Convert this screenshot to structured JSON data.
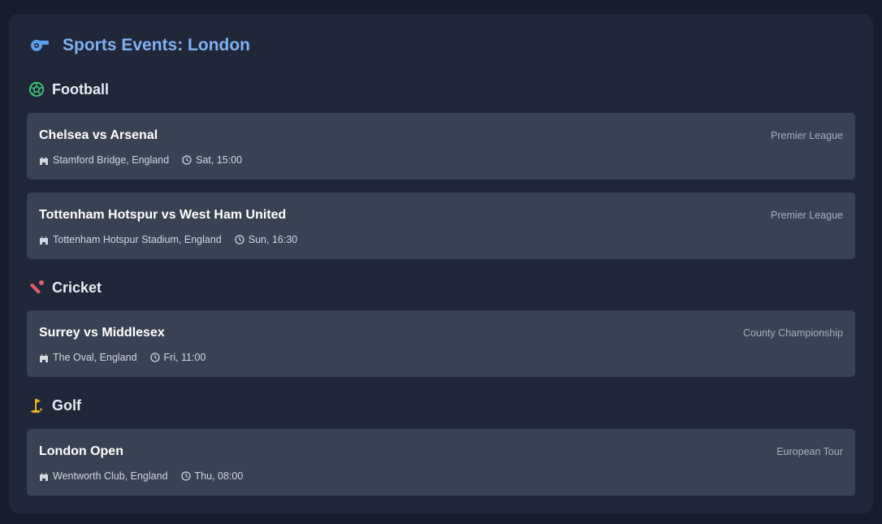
{
  "header": {
    "title": "Sports Events: London",
    "icon": "whistle-icon",
    "color": "#7fb1f0"
  },
  "sections": [
    {
      "title": "Football",
      "icon": "football-icon",
      "icon_color": "#3ec97a",
      "events": [
        {
          "match": "Chelsea vs Arsenal",
          "league": "Premier League",
          "venue": "Stamford Bridge, England",
          "time": "Sat, 15:00"
        },
        {
          "match": "Tottenham Hotspur vs West Ham United",
          "league": "Premier League",
          "venue": "Tottenham Hotspur Stadium, England",
          "time": "Sun, 16:30"
        }
      ]
    },
    {
      "title": "Cricket",
      "icon": "cricket-icon",
      "icon_color": "#e25b6a",
      "events": [
        {
          "match": "Surrey vs Middlesex",
          "league": "County Championship",
          "venue": "The Oval, England",
          "time": "Fri, 11:00"
        }
      ]
    },
    {
      "title": "Golf",
      "icon": "golf-flag-icon",
      "icon_color": "#f2b01e",
      "events": [
        {
          "match": "London Open",
          "league": "European Tour",
          "venue": "Wentworth Club, England",
          "time": "Thu, 08:00"
        }
      ]
    }
  ]
}
